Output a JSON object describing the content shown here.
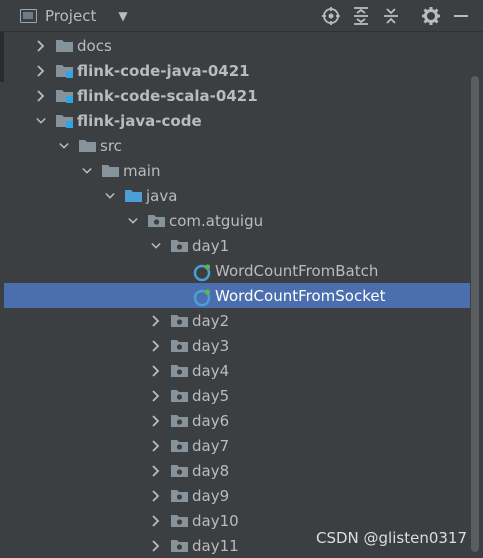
{
  "header": {
    "title": "Project",
    "icons": [
      "locate-icon",
      "expand-all-icon",
      "collapse-all-icon",
      "gear-icon",
      "minimize-icon"
    ]
  },
  "tree": {
    "rows": [
      {
        "label": "docs",
        "name": "tree-item-docs",
        "bold": false,
        "icon": "folder-icon",
        "expanded": false
      },
      {
        "label": "flink-code-java-0421",
        "name": "tree-item-flink-code-java-0421",
        "bold": true,
        "icon": "module-folder-icon",
        "expanded": false
      },
      {
        "label": "flink-code-scala-0421",
        "name": "tree-item-flink-code-scala-0421",
        "bold": true,
        "icon": "module-folder-icon",
        "expanded": false
      },
      {
        "label": "flink-java-code",
        "name": "tree-item-flink-java-code",
        "bold": true,
        "icon": "module-folder-icon",
        "expanded": true
      },
      {
        "label": "src",
        "name": "tree-item-src",
        "bold": false,
        "icon": "folder-icon",
        "expanded": true
      },
      {
        "label": "main",
        "name": "tree-item-main",
        "bold": false,
        "icon": "folder-icon",
        "expanded": true
      },
      {
        "label": "java",
        "name": "tree-item-java",
        "bold": false,
        "icon": "source-folder-icon",
        "expanded": true
      },
      {
        "label": "com.atguigu",
        "name": "tree-item-com-atguigu",
        "bold": false,
        "icon": "package-icon",
        "expanded": true
      },
      {
        "label": "day1",
        "name": "tree-item-day1",
        "bold": false,
        "icon": "package-icon",
        "expanded": true
      },
      {
        "label": "WordCountFromBatch",
        "name": "tree-item-wordcountfrombatch",
        "bold": false,
        "icon": "java-class-icon",
        "expanded": null
      },
      {
        "label": "WordCountFromSocket",
        "name": "tree-item-wordcountfromsocket",
        "bold": false,
        "icon": "java-class-icon",
        "expanded": null,
        "selected": true
      },
      {
        "label": "day2",
        "name": "tree-item-day2",
        "bold": false,
        "icon": "package-icon",
        "expanded": false
      },
      {
        "label": "day3",
        "name": "tree-item-day3",
        "bold": false,
        "icon": "package-icon",
        "expanded": false
      },
      {
        "label": "day4",
        "name": "tree-item-day4",
        "bold": false,
        "icon": "package-icon",
        "expanded": false
      },
      {
        "label": "day5",
        "name": "tree-item-day5",
        "bold": false,
        "icon": "package-icon",
        "expanded": false
      },
      {
        "label": "day6",
        "name": "tree-item-day6",
        "bold": false,
        "icon": "package-icon",
        "expanded": false
      },
      {
        "label": "day7",
        "name": "tree-item-day7",
        "bold": false,
        "icon": "package-icon",
        "expanded": false
      },
      {
        "label": "day8",
        "name": "tree-item-day8",
        "bold": false,
        "icon": "package-icon",
        "expanded": false
      },
      {
        "label": "day9",
        "name": "tree-item-day9",
        "bold": false,
        "icon": "package-icon",
        "expanded": false
      },
      {
        "label": "day10",
        "name": "tree-item-day10",
        "bold": false,
        "icon": "package-icon",
        "expanded": false
      },
      {
        "label": "day11",
        "name": "tree-item-day11",
        "bold": false,
        "icon": "package-icon",
        "expanded": false
      }
    ]
  },
  "colors": {
    "background": "#3c3f41",
    "selection": "#4b6eaf",
    "text": "#bbbbbb",
    "folder": "#87939a",
    "source_folder": "#4a9fd6",
    "module_marker": "#2fa4e7",
    "class_icon": "#4a9fd6"
  },
  "watermark": "CSDN @glisten0317"
}
